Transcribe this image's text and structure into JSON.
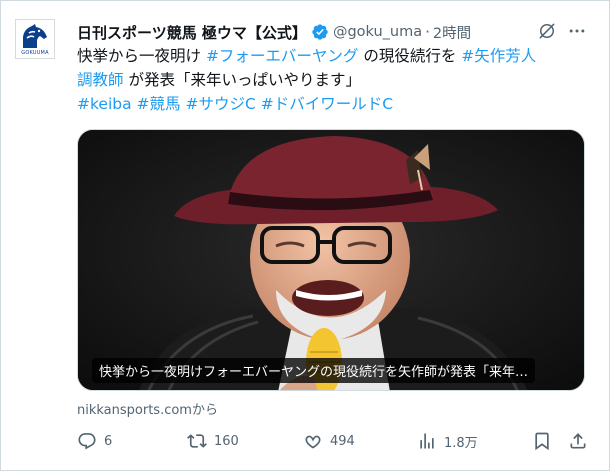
{
  "tweet": {
    "author_name": "日刊スポーツ競馬 極ウマ【公式】",
    "handle": "@goku_uma",
    "separator": "·",
    "time": "2時間",
    "avatar_brand_text": "GOKUUMA",
    "text": {
      "line1_a": "快挙から一夜明け ",
      "line1_tag": "#フォーエバーヤング",
      "line1_b": " の現役続行を ",
      "line1_tag2": "#矢作芳人",
      "line2_tag": "調教師",
      "line2_b": " が発表「来年いっぱいやります」",
      "tags": [
        "#keiba",
        "#競馬",
        "#サウジC",
        "#ドバイワールドC"
      ]
    },
    "media_caption": "快挙から一夜明けフォーエバーヤングの現役続行を矢作師が発表「来年…",
    "source_link": "nikkansports.comから",
    "actions": {
      "reply_count": "6",
      "retweet_count": "160",
      "like_count": "494",
      "views_count": "1.8万"
    }
  },
  "icons": {
    "verified": "verified-badge-icon",
    "grok": "grok-icon",
    "more": "more-icon",
    "reply": "reply-icon",
    "retweet": "retweet-icon",
    "like": "like-icon",
    "views": "views-icon",
    "bookmark": "bookmark-icon",
    "share": "share-icon"
  },
  "colors": {
    "text": "#0f1419",
    "secondary": "#536471",
    "hashtag": "#1d9bf0",
    "verified": "#1d9bf0",
    "border": "#cfd9de",
    "avatar_brand": "#0a3f8a"
  }
}
